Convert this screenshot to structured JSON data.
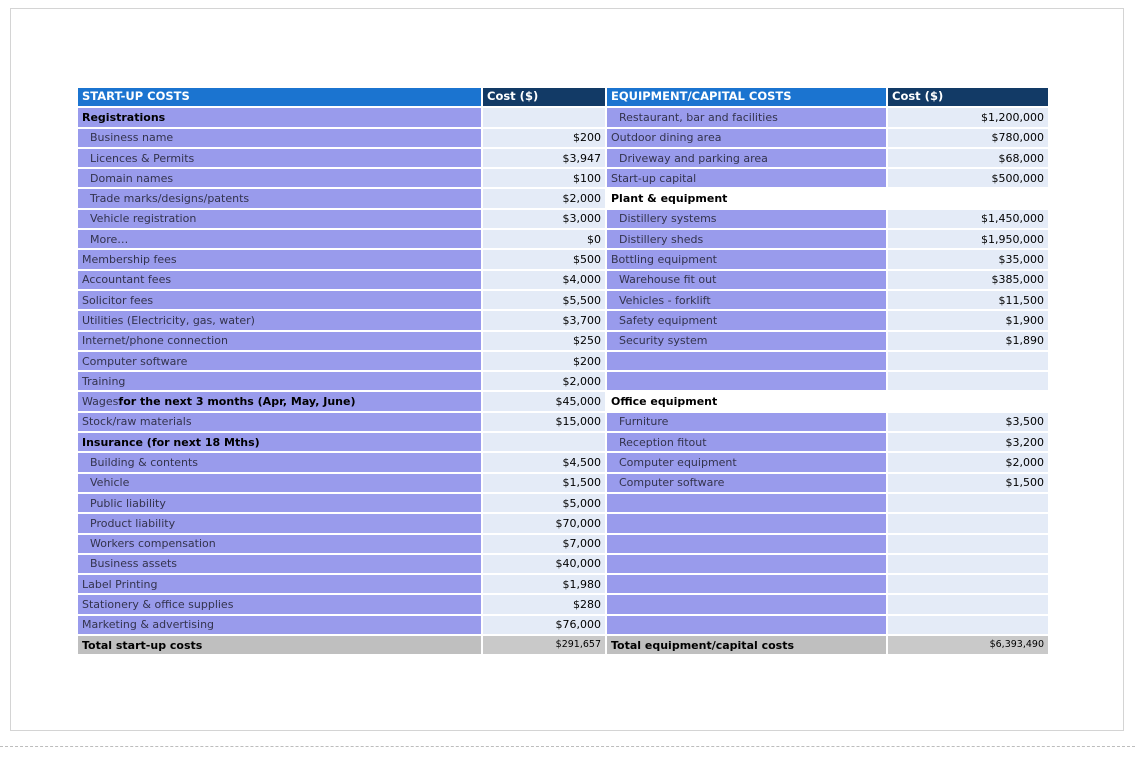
{
  "colors": {
    "header_blue": "#1B74D0",
    "header_navy": "#123A66",
    "row_purple": "#999BEC",
    "row_lightblue": "#E4EBF7",
    "section_white": "#FFFFFF",
    "total_gray": "#BFBFBF",
    "total_value_gray": "#C9C9C9"
  },
  "left_table": {
    "header": {
      "title": "START-UP COSTS",
      "cost": "Cost ($)"
    },
    "rows": [
      {
        "label": "Registrations",
        "style": "section",
        "value": ""
      },
      {
        "label": "Business name",
        "value": "$200",
        "indent": true
      },
      {
        "label": "Licences & Permits",
        "value": "$3,947",
        "indent": true
      },
      {
        "label": "Domain names",
        "value": "$100",
        "indent": true
      },
      {
        "label": "Trade marks/designs/patents",
        "value": "$2,000",
        "indent": true
      },
      {
        "label": "Vehicle registration",
        "value": "$3,000",
        "indent": true
      },
      {
        "label": "More…",
        "value": "$0",
        "indent": true
      },
      {
        "label": "Membership fees",
        "value": "$500"
      },
      {
        "label": "Accountant fees",
        "value": "$4,000"
      },
      {
        "label": "Solicitor fees",
        "value": "$5,500"
      },
      {
        "label": "Utilities (Electricity, gas, water)",
        "value": "$3,700"
      },
      {
        "label": "Internet/phone connection",
        "value": "$250"
      },
      {
        "label": "Computer software",
        "value": "$200"
      },
      {
        "label": "Training",
        "value": "$2,000"
      },
      {
        "label": "Wages ",
        "bold_suffix": "for the next 3 months (Apr, May, June)",
        "value": "$45,000"
      },
      {
        "label": "Stock/raw materials",
        "value": "$15,000"
      },
      {
        "label": "Insurance (for next 18 Mths)",
        "style": "section",
        "value": ""
      },
      {
        "label": "Building & contents",
        "value": "$4,500",
        "indent": true
      },
      {
        "label": "Vehicle",
        "value": "$1,500",
        "indent": true
      },
      {
        "label": "Public liability",
        "value": "$5,000",
        "indent": true
      },
      {
        "label": "Product liability",
        "value": "$70,000",
        "indent": true
      },
      {
        "label": "Workers compensation",
        "value": "$7,000",
        "indent": true
      },
      {
        "label": "Business assets",
        "value": "$40,000",
        "indent": true
      },
      {
        "label": "Label Printing",
        "value": "$1,980"
      },
      {
        "label": "Stationery & office supplies",
        "value": "$280"
      },
      {
        "label": "Marketing & advertising",
        "value": "$76,000"
      }
    ],
    "total": {
      "label": "Total start-up costs",
      "value": "$291,657"
    }
  },
  "right_table": {
    "header": {
      "title": "EQUIPMENT/CAPITAL COSTS",
      "cost": "Cost ($)"
    },
    "rows": [
      {
        "label": "Restaurant, bar and facilities",
        "value": "$1,200,000",
        "indent": true
      },
      {
        "label": "Outdoor dining area",
        "value": "$780,000"
      },
      {
        "label": "Driveway and parking area",
        "value": "$68,000",
        "indent": true
      },
      {
        "label": "Start-up capital",
        "value": "$500,000"
      },
      {
        "label": "Plant & equipment",
        "style": "section-white",
        "value": ""
      },
      {
        "label": "Distillery systems",
        "value": "$1,450,000",
        "indent": true
      },
      {
        "label": "Distillery sheds",
        "value": "$1,950,000",
        "indent": true
      },
      {
        "label": "Bottling equipment",
        "value": "$35,000"
      },
      {
        "label": "Warehouse fit out",
        "value": "$385,000",
        "indent": true
      },
      {
        "label": "Vehicles - forklift",
        "value": "$11,500",
        "indent": true
      },
      {
        "label": "Safety equipment",
        "value": "$1,900",
        "indent": true
      },
      {
        "label": "Security system",
        "value": "$1,890",
        "indent": true
      },
      {
        "label": "",
        "style": "empty",
        "value": ""
      },
      {
        "label": "",
        "style": "empty",
        "value": ""
      },
      {
        "label": "Office equipment",
        "style": "section-white",
        "value": ""
      },
      {
        "label": "Furniture",
        "value": "$3,500",
        "indent": true
      },
      {
        "label": "Reception fitout",
        "value": "$3,200",
        "indent": true
      },
      {
        "label": "Computer equipment",
        "value": "$2,000",
        "indent": true
      },
      {
        "label": "Computer software",
        "value": "$1,500",
        "indent": true
      },
      {
        "label": "",
        "style": "empty",
        "value": ""
      },
      {
        "label": "",
        "style": "empty",
        "value": ""
      },
      {
        "label": "",
        "style": "empty",
        "value": ""
      },
      {
        "label": "",
        "style": "empty",
        "value": ""
      },
      {
        "label": "",
        "style": "empty",
        "value": ""
      },
      {
        "label": "",
        "style": "empty",
        "value": ""
      },
      {
        "label": "",
        "style": "empty",
        "value": ""
      }
    ],
    "total": {
      "label": "Total equipment/capital costs",
      "value": "$6,393,490"
    }
  }
}
